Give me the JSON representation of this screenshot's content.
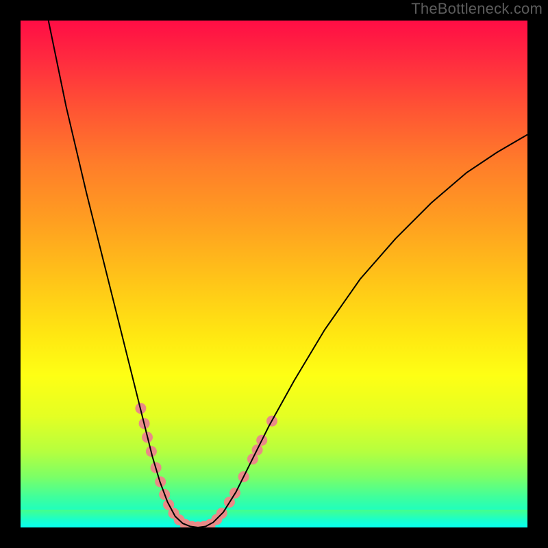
{
  "watermark": "TheBottleneck.com",
  "chart_data": {
    "type": "line",
    "title": "",
    "xlabel": "",
    "ylabel": "",
    "xlim": [
      0,
      1
    ],
    "ylim": [
      0,
      1
    ],
    "background_gradient": {
      "direction": "vertical",
      "stops": [
        {
          "pos": 0.0,
          "color": "#ff0d45"
        },
        {
          "pos": 0.4,
          "color": "#ffa020"
        },
        {
          "pos": 0.7,
          "color": "#feff14"
        },
        {
          "pos": 0.9,
          "color": "#7cff66"
        },
        {
          "pos": 1.0,
          "color": "#06fff1"
        }
      ]
    },
    "curve": {
      "stroke": "#000000",
      "width": 2,
      "points": [
        {
          "x": 0.055,
          "y": 1.0
        },
        {
          "x": 0.09,
          "y": 0.83
        },
        {
          "x": 0.13,
          "y": 0.66
        },
        {
          "x": 0.17,
          "y": 0.5
        },
        {
          "x": 0.2,
          "y": 0.38
        },
        {
          "x": 0.225,
          "y": 0.28
        },
        {
          "x": 0.245,
          "y": 0.2
        },
        {
          "x": 0.26,
          "y": 0.14
        },
        {
          "x": 0.275,
          "y": 0.09
        },
        {
          "x": 0.29,
          "y": 0.05
        },
        {
          "x": 0.305,
          "y": 0.022
        },
        {
          "x": 0.32,
          "y": 0.008
        },
        {
          "x": 0.335,
          "y": 0.002
        },
        {
          "x": 0.35,
          "y": 0.0
        },
        {
          "x": 0.365,
          "y": 0.002
        },
        {
          "x": 0.38,
          "y": 0.01
        },
        {
          "x": 0.4,
          "y": 0.03
        },
        {
          "x": 0.425,
          "y": 0.07
        },
        {
          "x": 0.455,
          "y": 0.13
        },
        {
          "x": 0.49,
          "y": 0.2
        },
        {
          "x": 0.54,
          "y": 0.29
        },
        {
          "x": 0.6,
          "y": 0.39
        },
        {
          "x": 0.67,
          "y": 0.49
        },
        {
          "x": 0.74,
          "y": 0.57
        },
        {
          "x": 0.81,
          "y": 0.64
        },
        {
          "x": 0.88,
          "y": 0.7
        },
        {
          "x": 0.94,
          "y": 0.74
        },
        {
          "x": 1.0,
          "y": 0.775
        }
      ]
    },
    "markers": {
      "color": "#e98a87",
      "radius_px": 8,
      "points": [
        {
          "x": 0.237,
          "y": 0.235
        },
        {
          "x": 0.244,
          "y": 0.205
        },
        {
          "x": 0.25,
          "y": 0.178
        },
        {
          "x": 0.258,
          "y": 0.15
        },
        {
          "x": 0.267,
          "y": 0.118
        },
        {
          "x": 0.276,
          "y": 0.09
        },
        {
          "x": 0.284,
          "y": 0.065
        },
        {
          "x": 0.292,
          "y": 0.045
        },
        {
          "x": 0.302,
          "y": 0.028
        },
        {
          "x": 0.313,
          "y": 0.015
        },
        {
          "x": 0.325,
          "y": 0.006
        },
        {
          "x": 0.338,
          "y": 0.002
        },
        {
          "x": 0.35,
          "y": 0.001
        },
        {
          "x": 0.362,
          "y": 0.002
        },
        {
          "x": 0.374,
          "y": 0.006
        },
        {
          "x": 0.387,
          "y": 0.016
        },
        {
          "x": 0.397,
          "y": 0.028
        },
        {
          "x": 0.412,
          "y": 0.05
        },
        {
          "x": 0.423,
          "y": 0.068
        },
        {
          "x": 0.44,
          "y": 0.1
        },
        {
          "x": 0.458,
          "y": 0.135
        },
        {
          "x": 0.467,
          "y": 0.153
        },
        {
          "x": 0.476,
          "y": 0.172
        },
        {
          "x": 0.496,
          "y": 0.21
        }
      ]
    }
  }
}
